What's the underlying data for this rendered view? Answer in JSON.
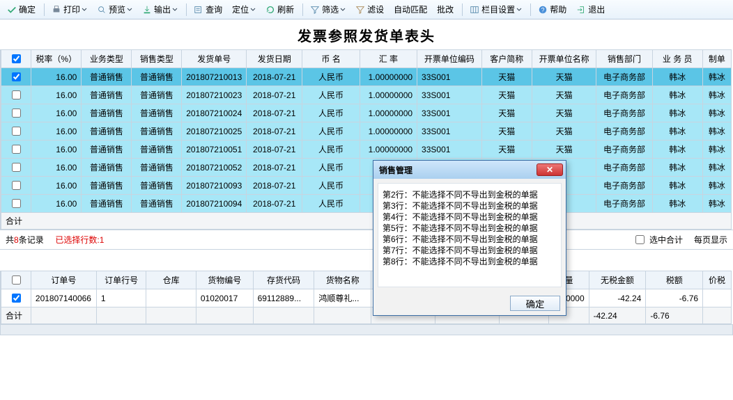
{
  "toolbar": {
    "confirm": "确定",
    "print": "打印",
    "preview": "预览",
    "export": "输出",
    "query": "查询",
    "locate": "定位",
    "refresh": "刷新",
    "filter": "筛选",
    "filter2": "滤设",
    "automatch": "自动匹配",
    "batch": "批改",
    "columns": "栏目设置",
    "help": "帮助",
    "exit": "退出"
  },
  "page_title": "发票参照发货单表头",
  "headers": [
    "税率（%）",
    "业务类型",
    "销售类型",
    "发货单号",
    "发货日期",
    "币 名",
    "汇 率",
    "开票单位编码",
    "客户简称",
    "开票单位名称",
    "销售部门",
    "业 务 员",
    "制单"
  ],
  "rows": [
    {
      "sel": true,
      "tax": "16.00",
      "biz": "普通销售",
      "sale": "普通销售",
      "no": "201807210013",
      "date": "2018-07-21",
      "cur": "人民币",
      "rate": "1.00000000",
      "code": "33S001",
      "cust": "天猫",
      "bill": "天猫",
      "dept": "电子商务部",
      "emp": "韩冰",
      "maker": "韩冰"
    },
    {
      "sel": false,
      "tax": "16.00",
      "biz": "普通销售",
      "sale": "普通销售",
      "no": "201807210023",
      "date": "2018-07-21",
      "cur": "人民币",
      "rate": "1.00000000",
      "code": "33S001",
      "cust": "天猫",
      "bill": "天猫",
      "dept": "电子商务部",
      "emp": "韩冰",
      "maker": "韩冰"
    },
    {
      "sel": false,
      "tax": "16.00",
      "biz": "普通销售",
      "sale": "普通销售",
      "no": "201807210024",
      "date": "2018-07-21",
      "cur": "人民币",
      "rate": "1.00000000",
      "code": "33S001",
      "cust": "天猫",
      "bill": "天猫",
      "dept": "电子商务部",
      "emp": "韩冰",
      "maker": "韩冰"
    },
    {
      "sel": false,
      "tax": "16.00",
      "biz": "普通销售",
      "sale": "普通销售",
      "no": "201807210025",
      "date": "2018-07-21",
      "cur": "人民币",
      "rate": "1.00000000",
      "code": "33S001",
      "cust": "天猫",
      "bill": "天猫",
      "dept": "电子商务部",
      "emp": "韩冰",
      "maker": "韩冰"
    },
    {
      "sel": false,
      "tax": "16.00",
      "biz": "普通销售",
      "sale": "普通销售",
      "no": "201807210051",
      "date": "2018-07-21",
      "cur": "人民币",
      "rate": "1.00000000",
      "code": "33S001",
      "cust": "天猫",
      "bill": "天猫",
      "dept": "电子商务部",
      "emp": "韩冰",
      "maker": "韩冰"
    },
    {
      "sel": false,
      "tax": "16.00",
      "biz": "普通销售",
      "sale": "普通销售",
      "no": "201807210052",
      "date": "2018-07-21",
      "cur": "人民币",
      "rate": "",
      "code": "",
      "cust": "",
      "bill": "",
      "dept": "电子商务部",
      "emp": "韩冰",
      "maker": "韩冰"
    },
    {
      "sel": false,
      "tax": "16.00",
      "biz": "普通销售",
      "sale": "普通销售",
      "no": "201807210093",
      "date": "2018-07-21",
      "cur": "人民币",
      "rate": "",
      "code": "",
      "cust": "",
      "bill": "",
      "dept": "电子商务部",
      "emp": "韩冰",
      "maker": "韩冰"
    },
    {
      "sel": false,
      "tax": "16.00",
      "biz": "普通销售",
      "sale": "普通销售",
      "no": "201807210094",
      "date": "2018-07-21",
      "cur": "人民币",
      "rate": "",
      "code": "",
      "cust": "",
      "bill": "",
      "dept": "电子商务部",
      "emp": "韩冰",
      "maker": "韩冰"
    }
  ],
  "sum_label": "合计",
  "status": {
    "total_pre": "共",
    "total_n": "8",
    "total_post": "条记录",
    "sel_pre": "已选择行数:",
    "sel_n": "1",
    "opt": "选中合计",
    "perpage": "每页显示"
  },
  "headers2": [
    "订单号",
    "订单行号",
    "仓库",
    "货物编号",
    "存货代码",
    "货物名称",
    "",
    "",
    "",
    "量",
    "无税金额",
    "税额",
    "价税"
  ],
  "rows2": [
    {
      "sel": true,
      "order": "201807140066",
      "line": "1",
      "wh": "",
      "code": "01020017",
      "inv": "69112889...",
      "name": "鸿顺尊礼...",
      "qty": "0.0000",
      "amt": "-42.24",
      "tax": "-6.76"
    }
  ],
  "sum2": {
    "amt": "-42.24",
    "tax": "-6.76"
  },
  "modal": {
    "title": "销售管理",
    "lines": [
      "第2行：不能选择不同不导出到金税的单据",
      "第3行：不能选择不同不导出到金税的单据",
      "第4行：不能选择不同不导出到金税的单据",
      "第5行：不能选择不同不导出到金税的单据",
      "第6行：不能选择不同不导出到金税的单据",
      "第7行：不能选择不同不导出到金税的单据",
      "第8行：不能选择不同不导出到金税的单据"
    ],
    "ok": "确定"
  }
}
